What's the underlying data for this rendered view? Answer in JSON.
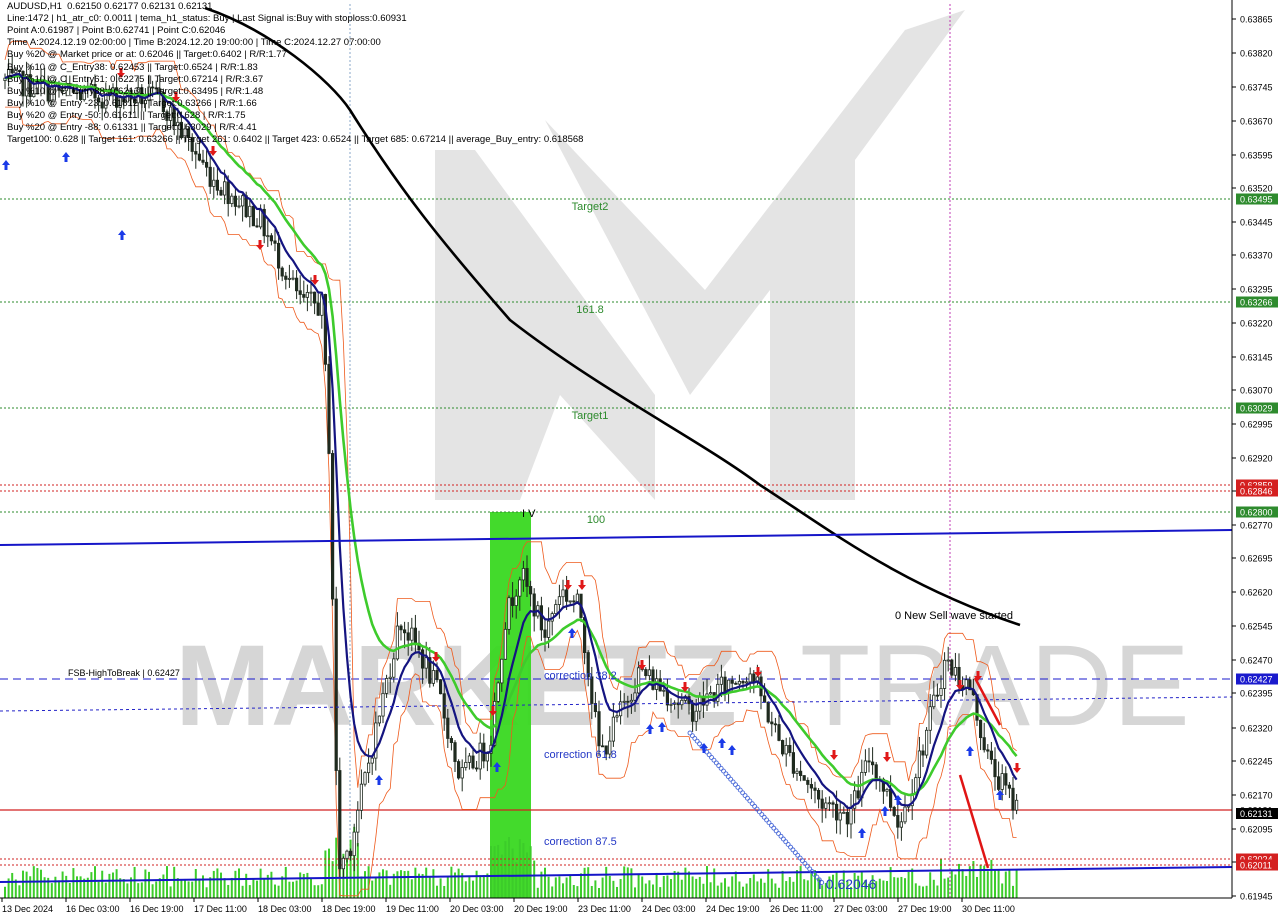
{
  "header": {
    "lines": [
      "AUDUSD,H1  0.62150 0.62177 0.62131 0.62131",
      "Line:1472 | h1_atr_c0: 0.0011 | tema_h1_status: Buy | Last Signal is:Buy with stoploss:0.60931",
      "Point A:0.61987 | Point B:0.62741 | Point C:0.62046",
      "Time A:2024.12.19 02:00:00 | Time B:2024.12.20 19:00:00 | Time C:2024.12.27 07:00:00",
      "Buy %20 @ Market price or at: 0.62046 || Target:0.6402 | R/R:1.77",
      "Buy %10 @ C_Entry38: 0.62453 || Target:0.6524 | R/R:1.83",
      "Buy %10 @ C_Entry61: 0.62275 || Target:0.67214 | R/R:3.67",
      "Buy %10 @ C_Entry88: 0.62131 || Target:0.63495 | R/R:1.48",
      "Buy %10 @ Entry -23: 0.61812 || Target:0.63266 | R/R:1.66",
      "Buy %20 @ Entry -50: 0.61611 || Target:0.628 | R/R:1.75",
      "Buy %20 @ Entry -88: 0.61331 || Target:0.63029 | R/R:4.41",
      "Target100: 0.628 || Target 161: 0.63266 || Target 261: 0.6402 || Target 423: 0.6524 || Target 685: 0.67214 || average_Buy_entry: 0.618568"
    ]
  },
  "chart_data": {
    "type": "candlestick",
    "symbol": "AUDUSD",
    "timeframe": "H1",
    "ylim": [
      0.61935,
      0.6392
    ],
    "grid": false,
    "price_axis_ticks": [
      "0.63865",
      "0.63820",
      "0.63745",
      "0.63670",
      "0.63595",
      "0.63520",
      "0.63445",
      "0.63370",
      "0.63295",
      "0.63220",
      "0.63145",
      "0.63070",
      "0.62995",
      "0.62920",
      "0.62845",
      "0.62770",
      "0.62695",
      "0.62620",
      "0.62545",
      "0.62470",
      "0.62395",
      "0.62320",
      "0.62245",
      "0.62170",
      "0.62095",
      "0.62020",
      "0.61945"
    ],
    "time_axis_labels": [
      "13 Dec 2024",
      "16 Dec 03:00",
      "16 Dec 19:00",
      "17 Dec 11:00",
      "18 Dec 03:00",
      "18 Dec 19:00",
      "19 Dec 11:00",
      "20 Dec 03:00",
      "20 Dec 19:00",
      "23 Dec 11:00",
      "24 Dec 03:00",
      "24 Dec 19:00",
      "26 Dec 11:00",
      "27 Dec 03:00",
      "27 Dec 19:00",
      "30 Dec 11:00"
    ],
    "price_levels": [
      {
        "label": "Target2",
        "value": 0.63495,
        "color": "#2e8b2e",
        "badge": "0.63495"
      },
      {
        "label": "161.8",
        "value": 0.63266,
        "color": "#2e8b2e",
        "badge": "0.63266"
      },
      {
        "label": "Target1",
        "value": 0.63029,
        "color": "#2e8b2e",
        "badge": "0.63029"
      },
      {
        "label": "",
        "value": 0.62859,
        "color": "#d22020",
        "badge": "0.62859"
      },
      {
        "label": "",
        "value": 0.62846,
        "color": "#d22020",
        "badge": "0.62846"
      },
      {
        "label": "100",
        "value": 0.628,
        "color": "#2e8b2e",
        "badge": "0.62800"
      },
      {
        "label": "FSB-HighToBreak | 0.62427",
        "value": 0.62427,
        "color": "#1a1acd",
        "badge": "0.62427"
      },
      {
        "label": "",
        "value": 0.62131,
        "color": "#d22020",
        "badge": "0.62131"
      },
      {
        "label": "",
        "value": 0.62024,
        "color": "#d22020",
        "badge": "0.62024"
      },
      {
        "label": "",
        "value": 0.62011,
        "color": "#d22020",
        "badge": "0.62011"
      }
    ],
    "annotations": [
      "I V",
      "correction 38.2",
      "correction 61.8",
      "correction 87.5",
      "0 New Sell wave started",
      "I 0.62046"
    ],
    "current_price": 0.62131,
    "watermark": "MARKETZI TRADE"
  }
}
